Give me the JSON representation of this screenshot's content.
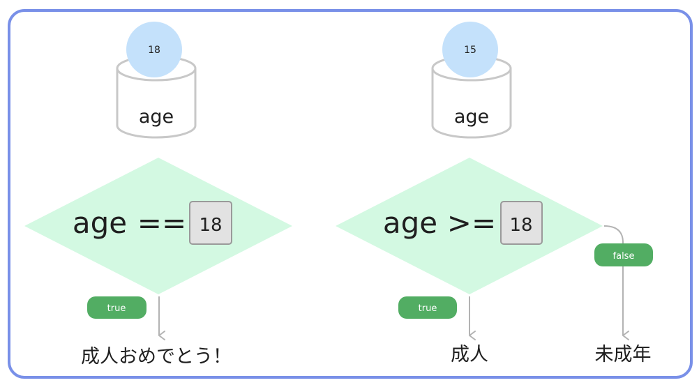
{
  "colors": {
    "frame": "#7990e8",
    "diamond": "#d3f9e2",
    "ball": "#c4e1fb",
    "cylinder_stroke": "#c8c8c8",
    "value_box_fill": "#e2e2e2",
    "value_box_stroke": "#9a9a9a",
    "badge": "#52ad63",
    "arrow": "#b3b3b3",
    "text": "#1f1f1f"
  },
  "left": {
    "ball_value": "18",
    "variable_name": "age",
    "condition_variable": "age",
    "operator": "==",
    "compare_value": "18",
    "true_label": "true",
    "true_result": "成人おめでとう！"
  },
  "right": {
    "ball_value": "15",
    "variable_name": "age",
    "condition_variable": "age",
    "operator": ">=",
    "compare_value": "18",
    "true_label": "true",
    "true_result": "成人",
    "false_label": "false",
    "false_result": "未成年"
  }
}
